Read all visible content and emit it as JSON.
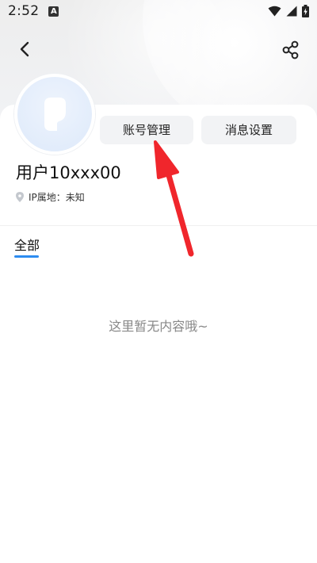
{
  "status_bar": {
    "time": "2:52",
    "notification_icon": "a-icon",
    "wifi_icon": "wifi-icon",
    "signal_icon": "signal-icon",
    "battery_icon": "battery-icon"
  },
  "top_bar": {
    "back_icon": "chevron-left-icon",
    "share_icon": "share-icon"
  },
  "profile": {
    "username": "用户10xxx00",
    "ip_location": "IP属地：未知",
    "account_button": "账号管理",
    "message_button": "消息设置"
  },
  "tabs": [
    {
      "label": "全部",
      "active": true
    }
  ],
  "content": {
    "empty_message": "这里暂无内容哦~"
  },
  "colors": {
    "accent": "#2d8cf0",
    "annotation_arrow": "#f0262c"
  }
}
